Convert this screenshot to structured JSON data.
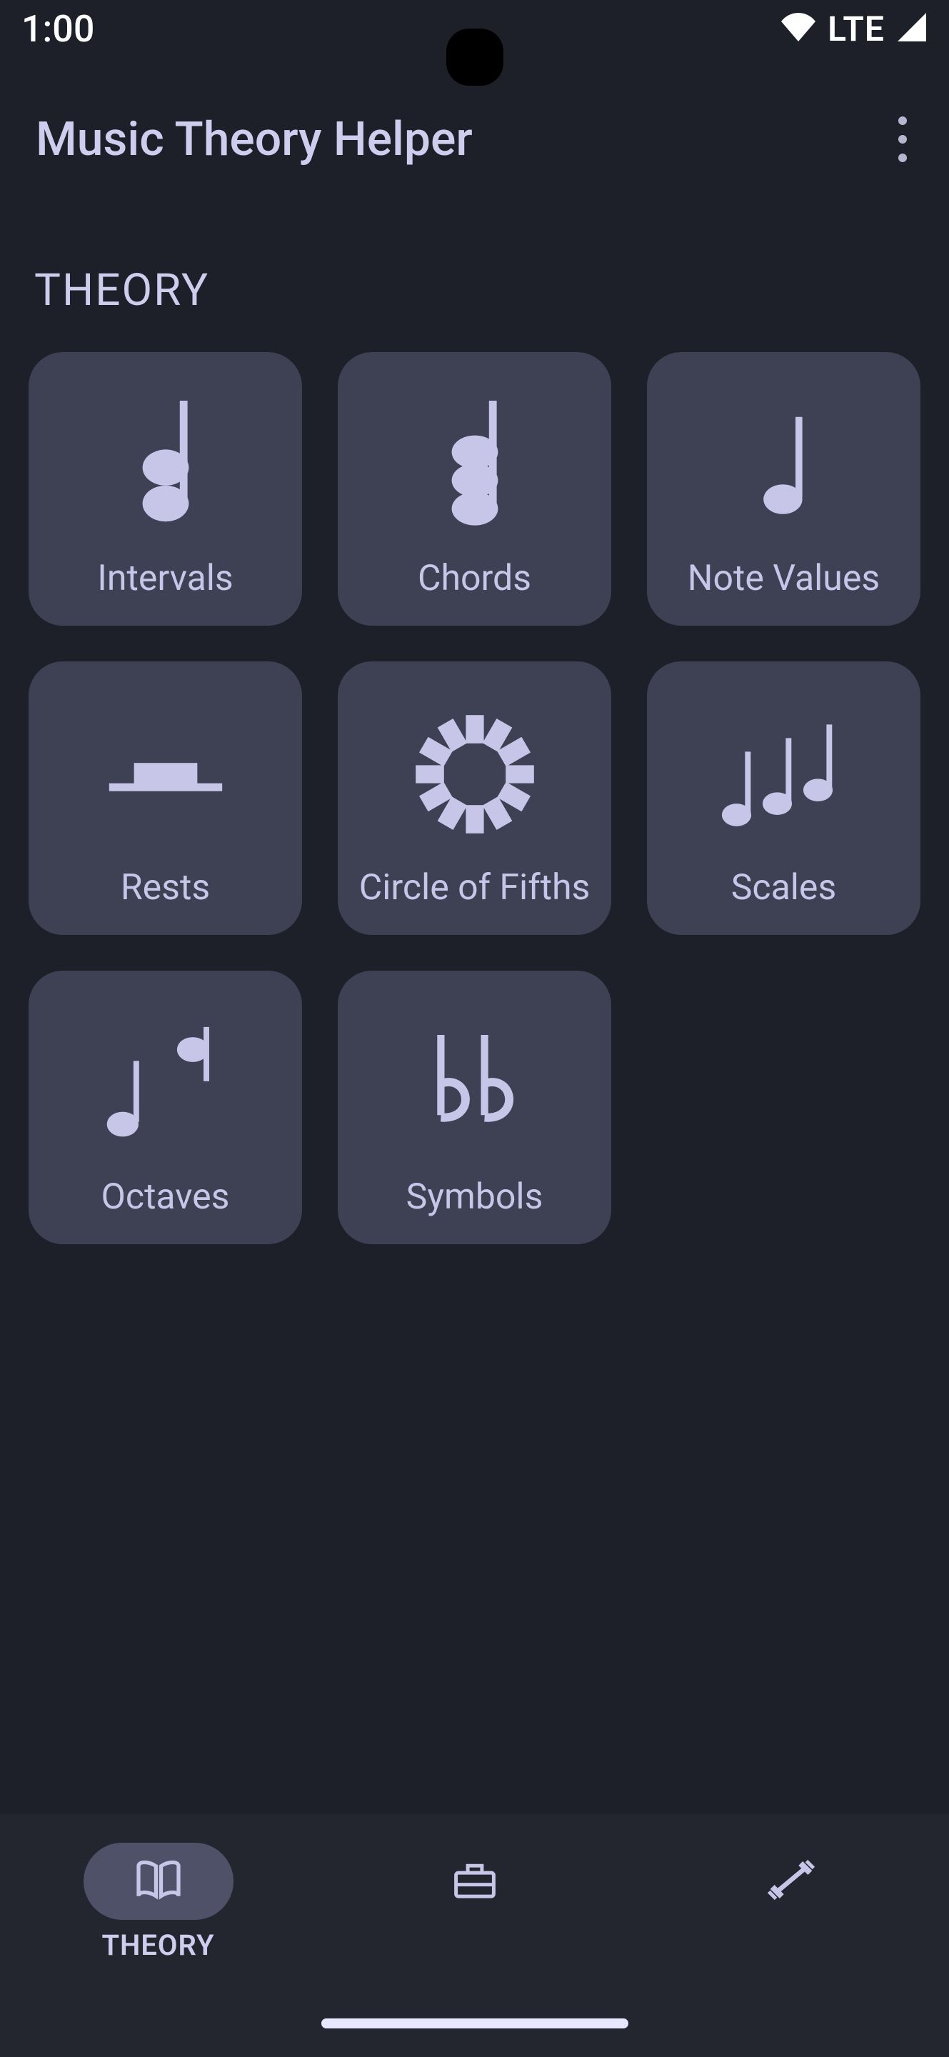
{
  "status": {
    "time": "1:00",
    "network": "LTE"
  },
  "appbar": {
    "title": "Music Theory Helper"
  },
  "section": {
    "title": "THEORY"
  },
  "cards": {
    "intervals": "Intervals",
    "chords": "Chords",
    "note_values": "Note Values",
    "rests": "Rests",
    "circle_of_fifths": "Circle of Fifths",
    "scales": "Scales",
    "octaves": "Octaves",
    "symbols": "Symbols"
  },
  "nav": {
    "theory": "THEORY"
  }
}
